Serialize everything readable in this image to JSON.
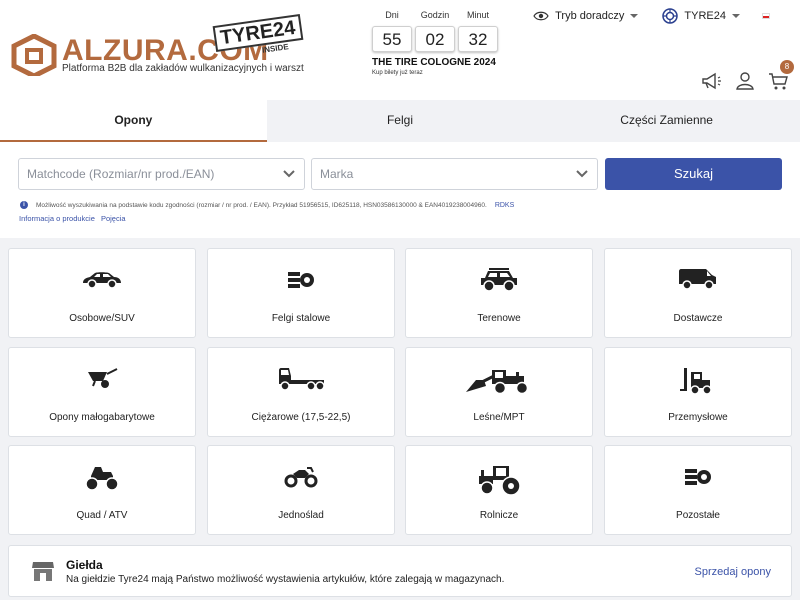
{
  "header": {
    "logo_text": "ALZURA",
    "logo_suffix": ".COM",
    "tyre24_badge": "TYRE24",
    "tyre24_inside": "INSIDE",
    "subtitle": "Platforma B2B dla zakładów wulkanizacyjnych i warszt",
    "advisor_mode": "Tryb doradczy",
    "account": "TYRE24",
    "cart_count": "8"
  },
  "countdown": {
    "labels": [
      "Dni",
      "Godzin",
      "Minut"
    ],
    "values": [
      "55",
      "02",
      "32"
    ],
    "event": "THE TIRE COLOGNE 2024",
    "cta": "Kup bilety już teraz"
  },
  "tabs": [
    "Opony",
    "Felgi",
    "Części Zamienne"
  ],
  "search": {
    "matchcode_placeholder": "Matchcode (Rozmiar/nr prod./EAN)",
    "brand_placeholder": "Marka",
    "button": "Szukaj",
    "info": "Możliwość wyszukiwania na podstawie kodu zgodności (rozmiar / nr prod. / EAN). Przykład 51956515, ID625118, HSN03586130000 & EAN4019238004960.",
    "rdks": "RDKS",
    "link_product_info": "Informacja o produkcie",
    "link_terms": "Pojęcia"
  },
  "categories": [
    {
      "label": "Osobowe/SUV",
      "icon": "car-icon"
    },
    {
      "label": "Felgi stalowe",
      "icon": "steel-rim-icon"
    },
    {
      "label": "Terenowe",
      "icon": "offroad-icon"
    },
    {
      "label": "Dostawcze",
      "icon": "van-icon"
    },
    {
      "label": "Opony małogabarytowe",
      "icon": "wheelbarrow-icon"
    },
    {
      "label": "Ciężarowe (17,5-22,5)",
      "icon": "truck-icon"
    },
    {
      "label": "Leśne/MPT",
      "icon": "loader-icon"
    },
    {
      "label": "Przemysłowe",
      "icon": "forklift-icon"
    },
    {
      "label": "Quad / ATV",
      "icon": "quad-icon"
    },
    {
      "label": "Jednoślad",
      "icon": "motorcycle-icon"
    },
    {
      "label": "Rolnicze",
      "icon": "tractor-icon"
    },
    {
      "label": "Pozostałe",
      "icon": "tire-stack-icon"
    }
  ],
  "exchange": {
    "title": "Giełda",
    "description": "Na giełdzie Tyre24 mają Państwo możliwość wystawienia artykułów, które zalegają w magazynach.",
    "sell_link": "Sprzedaj opony"
  },
  "colors": {
    "brand": "#b36a3e",
    "primary": "#3b53a8"
  }
}
